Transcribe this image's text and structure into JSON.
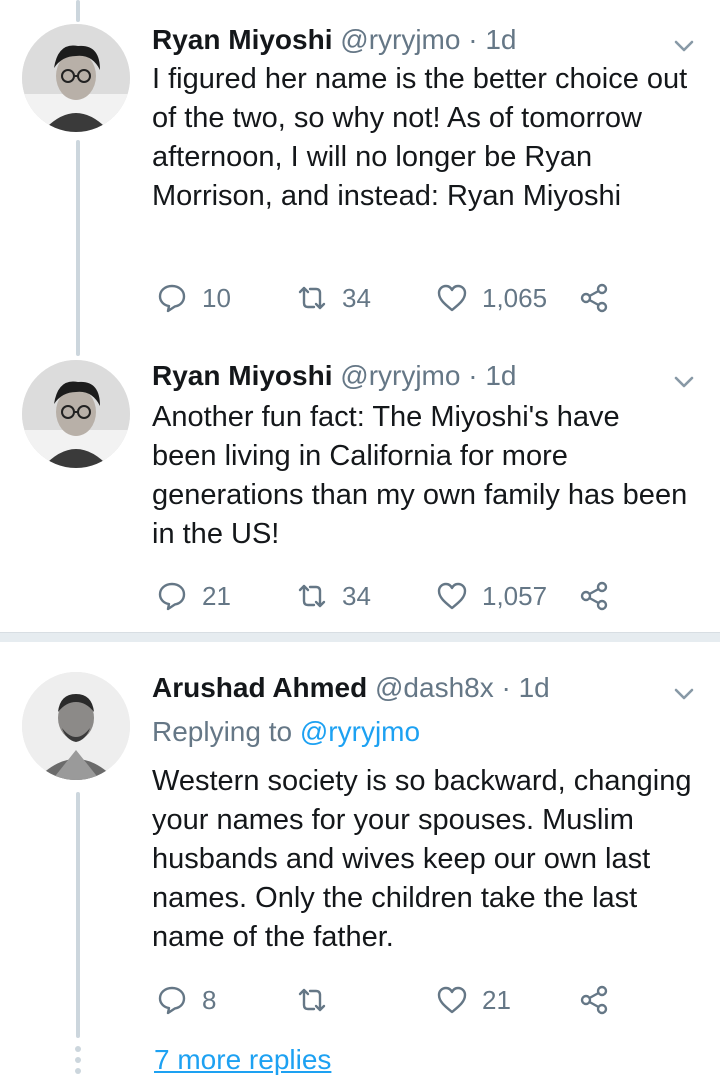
{
  "tweets": [
    {
      "name": "Ryan Miyoshi",
      "handle": "@ryryjmo",
      "dot": "·",
      "time": "1d",
      "reply_prefix": "",
      "reply_mention": "",
      "text": "I figured her name is the better choice out of the two, so why not! As of tomorrow afternoon, I will no longer be Ryan Morrison, and instead: Ryan Miyoshi",
      "replies": "10",
      "retweets": "34",
      "likes": "1,065"
    },
    {
      "name": "Ryan Miyoshi",
      "handle": "@ryryjmo",
      "dot": "·",
      "time": "1d",
      "reply_prefix": "",
      "reply_mention": "",
      "text": "Another fun fact: The Miyoshi's have been living in California for more generations than my own family has been in the US!",
      "replies": "21",
      "retweets": "34",
      "likes": "1,057"
    },
    {
      "name": "Arushad Ahmed",
      "handle": "@dash8x",
      "dot": "·",
      "time": "1d",
      "reply_prefix": "Replying to",
      "reply_mention": "@ryryjmo",
      "text": "Western society is so backward, changing your names for your spouses. Muslim husbands and wives keep our own last names. Only the children take the last name of the father.",
      "replies": "8",
      "retweets": "",
      "likes": "21"
    }
  ],
  "more_replies": "7 more replies",
  "colors": {
    "text": "#14171a",
    "muted": "#657786",
    "accent": "#1da1f2",
    "thread_line": "#ccd6dd",
    "divider": "#e6ecf0"
  },
  "icons": [
    "reply-icon",
    "retweet-icon",
    "like-icon",
    "share-icon",
    "chevron-down-icon"
  ]
}
